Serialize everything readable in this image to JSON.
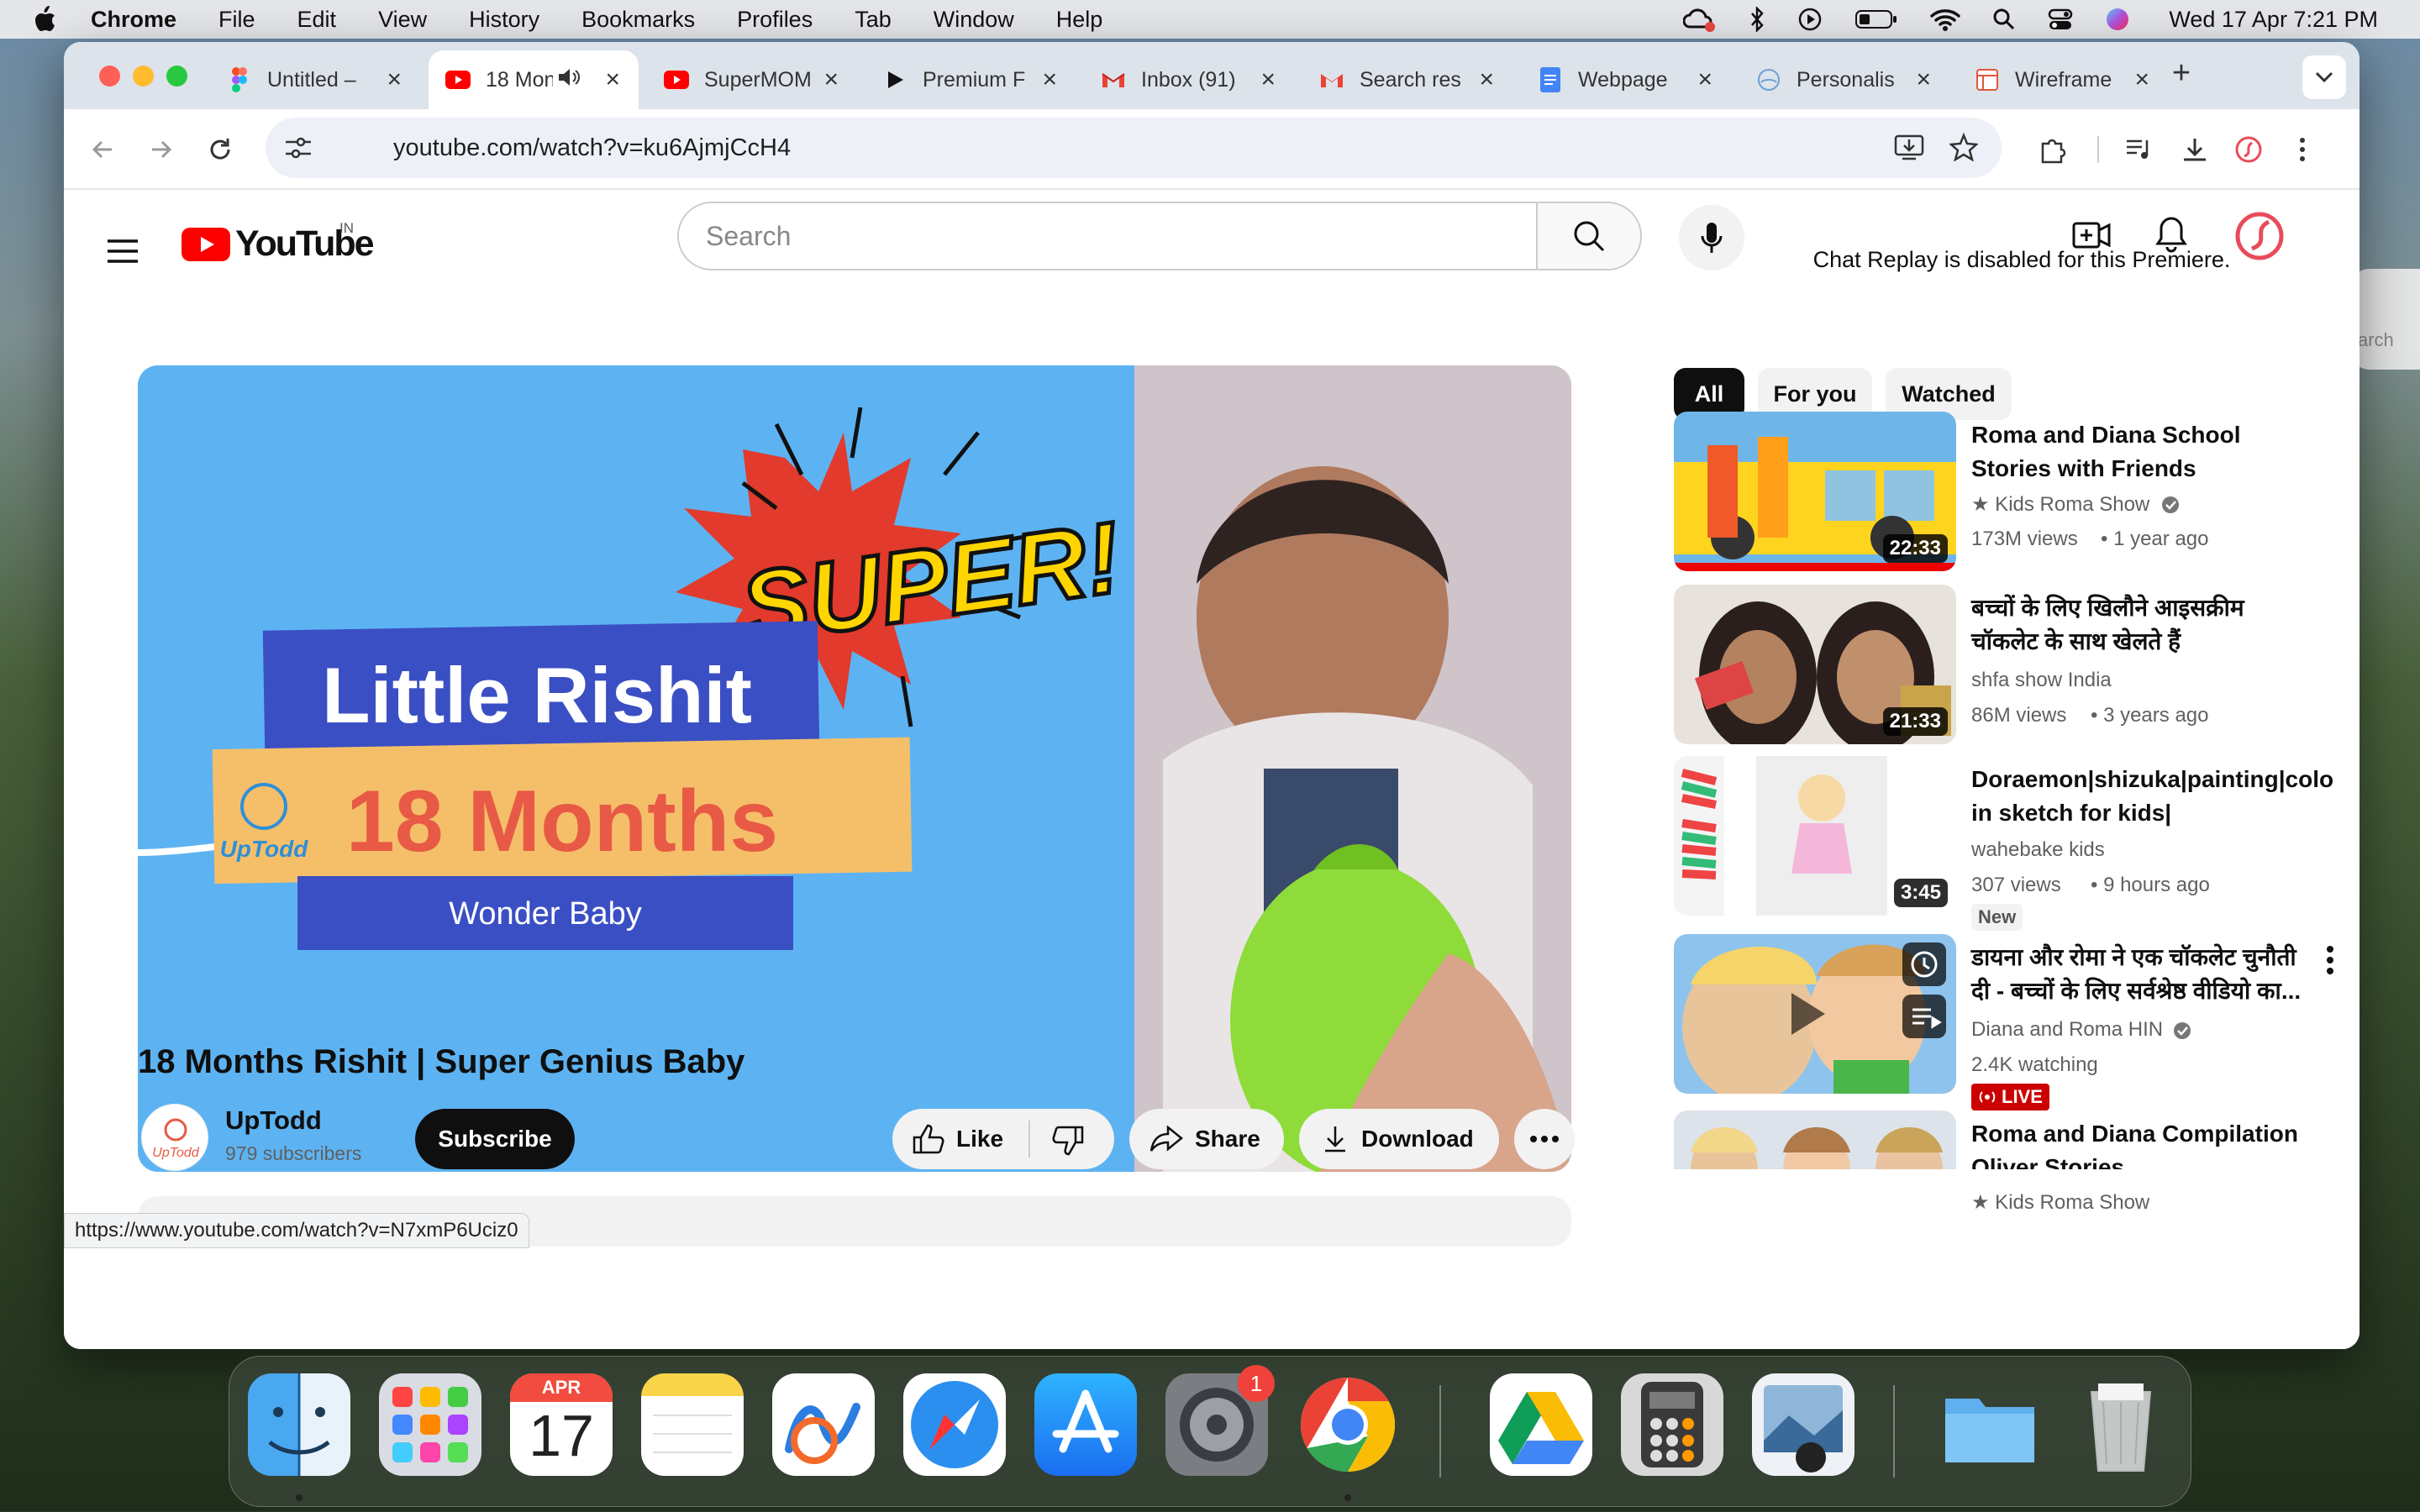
{
  "menubar": {
    "app": "Chrome",
    "items": [
      "File",
      "Edit",
      "View",
      "History",
      "Bookmarks",
      "Profiles",
      "Tab",
      "Window",
      "Help"
    ],
    "clock": "Wed 17 Apr  7:21 PM",
    "status_icons": [
      "creative-cloud-icon",
      "bluetooth-icon",
      "play-icon",
      "battery-icon",
      "wifi-icon",
      "spotlight-icon",
      "control-center-icon",
      "siri-icon"
    ]
  },
  "desktop_widget": {
    "label": "arch"
  },
  "tabs": [
    {
      "title": "Untitled –",
      "icon": "figma-icon"
    },
    {
      "title": "18 Mon",
      "icon": "youtube-icon",
      "active": true
    },
    {
      "title": "SuperMOM",
      "icon": "youtube-icon"
    },
    {
      "title": "Premium F",
      "icon": "play-icon"
    },
    {
      "title": "Inbox (91)",
      "icon": "gmail-icon"
    },
    {
      "title": "Search res",
      "icon": "gmail-icon"
    },
    {
      "title": "Webpage",
      "icon": "docs-icon"
    },
    {
      "title": "Personalis",
      "icon": "globe-icon"
    },
    {
      "title": "Wireframe",
      "icon": "wireframe-icon"
    }
  ],
  "address": {
    "url": "youtube.com/watch?v=ku6AjmjCcH4"
  },
  "youtube": {
    "logo_text": "YouTube",
    "country": "IN",
    "search_placeholder": "Search",
    "video": {
      "title": "18 Months Rishit | Super Genius Baby",
      "thumb_super": "SUPER!",
      "thumb_name": "Little Rishit",
      "thumb_age": "18 Months",
      "thumb_sub": "Wonder Baby",
      "thumb_brand": "UpTodd"
    },
    "channel": {
      "name": "UpTodd",
      "subs": "979 subscribers",
      "avatar_text": "UpTodd"
    },
    "subscribe": "Subscribe",
    "actions": {
      "like": "Like",
      "share": "Share",
      "download": "Download"
    },
    "chat_message": "Chat Replay is disabled for this Premiere.",
    "chips": [
      "All",
      "For you",
      "Watched"
    ],
    "recommendations": [
      {
        "title": "Roma and Diana School Stories with Friends",
        "channel": "★ Kids Roma Show",
        "views": "173M views",
        "age": "1 year ago",
        "duration": "22:33",
        "verified": true
      },
      {
        "title": "बच्चों के लिए खिलौने आइसक्रीम चॉकलेट के साथ खेलते हैं",
        "channel": "shfa show India",
        "views": "86M views",
        "age": "3 years ago",
        "duration": "21:33"
      },
      {
        "title": "Doraemon|shizuka|painting|colo in sketch for kids|",
        "channel": "wahebake kids",
        "views": "307 views",
        "age": "9 hours ago",
        "duration": "3:45",
        "badge": "New"
      },
      {
        "title": "डायना और रोमा ने एक चॉकलेट चुनौती दी - बच्चों के लिए सर्वश्रेष्ठ वीडियो का...",
        "channel": "Diana and Roma HIN",
        "views": "2.4K watching",
        "live": "LIVE",
        "verified": true
      },
      {
        "title": "Roma and Diana Compilation Oliver Stories",
        "channel": "★ Kids Roma Show"
      }
    ]
  },
  "status_url": "https://www.youtube.com/watch?v=N7xmP6Uciz0",
  "dock": {
    "calendar_month": "APR",
    "calendar_day": "17",
    "settings_badge": "1",
    "apps": [
      "finder",
      "launchpad",
      "calendar",
      "notes",
      "freeform",
      "safari",
      "app-store",
      "system-settings",
      "chrome",
      "google-drive",
      "calculator",
      "preview",
      "folder",
      "trash"
    ]
  }
}
